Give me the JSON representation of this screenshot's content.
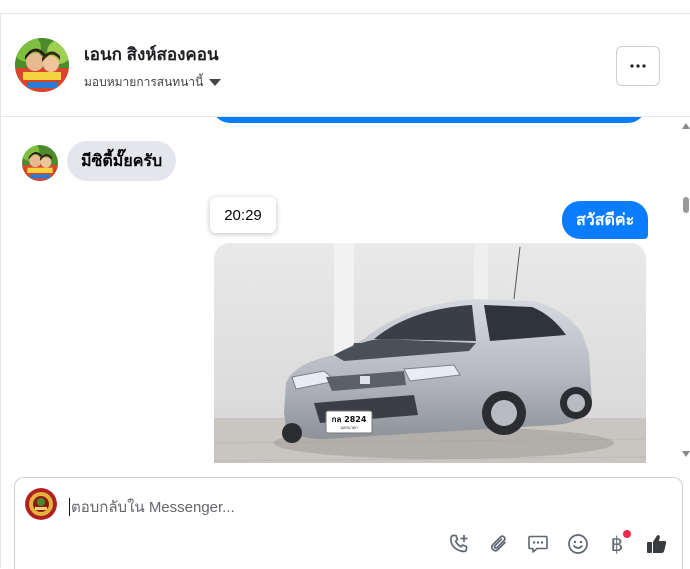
{
  "header": {
    "contact_name": "เอนก สิงห์สองคอน",
    "assign_label": "มอบหมายการสนทนานี้",
    "more_label": "···"
  },
  "chat": {
    "incoming_message": "มีซิตี้มั๊ยครับ",
    "timestamp_tooltip": "20:29",
    "outgoing_message": "สวัสดีค่ะ",
    "photo_plate": "กล 2824",
    "photo_plate_sub": "นครนายก"
  },
  "composer": {
    "placeholder": "ตอบกลับใน Messenger..."
  },
  "icons": {
    "call": "phone-plus-icon",
    "attach": "paperclip-icon",
    "saved_replies": "chat-bubble-icon",
    "emoji": "smiley-icon",
    "payment": "baht-icon",
    "like": "thumbs-up-icon"
  },
  "colors": {
    "brand_blue": "#0a7cff",
    "incoming_bubble": "#e4e6eb",
    "notification_red": "#f02849"
  }
}
